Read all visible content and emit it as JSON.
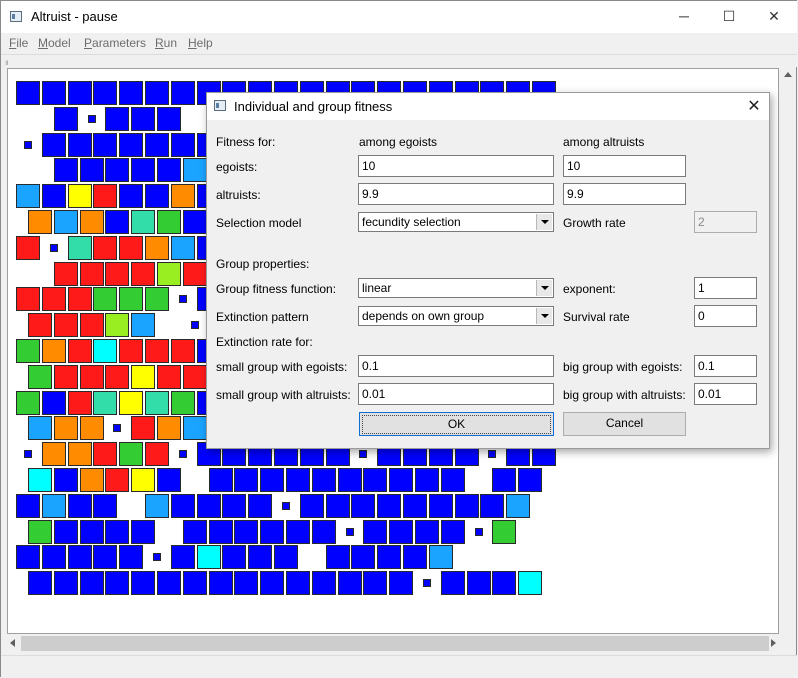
{
  "window": {
    "title": "Altruist - pause",
    "minimize": "─",
    "maximize": "☐",
    "close": "✕"
  },
  "menu": [
    {
      "label": "File",
      "key": "F",
      "rest": "ile"
    },
    {
      "label": "Model",
      "key": "M",
      "rest": "odel"
    },
    {
      "label": "Parameters",
      "key": "P",
      "rest": "arameters"
    },
    {
      "label": "Run",
      "key": "R",
      "rest": "un"
    },
    {
      "label": "Help",
      "key": "H",
      "rest": "elp"
    }
  ],
  "colors": {
    "blue": "#0000ff",
    "lightblue": "#1aa3ff",
    "skyblue": "#00b0ff",
    "cyan": "#00ffff",
    "turquoise": "#33e6e6",
    "teal": "#33ddaa",
    "green": "#33cc33",
    "lime": "#99ee22",
    "yellow": "#ffff00",
    "amber": "#ffcc00",
    "orange": "#ff8c00",
    "darkorange": "#ff6600",
    "redorange": "#ff3300",
    "red": "#ff1a1a"
  },
  "dialog": {
    "title": "Individual and group fitness",
    "close": "✕",
    "fitness_for_label": "Fitness for:",
    "among_egoists": "among egoists",
    "among_altruists": "among altruists",
    "egoists_label": "egoists:",
    "egoists_among_egoists": "10",
    "egoists_among_altruists": "10",
    "altruists_label": "altruists:",
    "altruists_among_egoists": "9.9",
    "altruists_among_altruists": "9.9",
    "selection_model_label": "Selection model",
    "selection_model": "fecundity selection",
    "growth_rate_label": "Growth rate",
    "growth_rate": "2",
    "group_properties_label": "Group properties:",
    "group_fitness_function_label": "Group fitness function:",
    "group_fitness_function": "linear",
    "exponent_label": "exponent:",
    "exponent": "1",
    "extinction_pattern_label": "Extinction pattern",
    "extinction_pattern": "depends on own group",
    "survival_rate_label": "Survival rate",
    "survival_rate": "0",
    "extinction_rate_for_label": "Extinction rate for:",
    "small_egoists_label": "small group with egoists:",
    "small_egoists": "0.1",
    "big_egoists_label": "big group with egoists:",
    "big_egoists": "0.1",
    "small_altruists_label": "small group with altruists:",
    "small_altruists": "0.01",
    "big_altruists_label": "big group with altruists:",
    "big_altruists": "0.01",
    "ok_label": "OK",
    "cancel_label": "Cancel"
  },
  "grid": {
    "rows": [
      "BBBBBBBBBBBBBBBBBBBBBB",
      "-BsBBB-sBBBBBBBBBBBBBB",
      "sBBBBBBBBBBBBBBBBBBBBB",
      "-BBBBBLBBBBBBBBBBBBBBB",
      "LBYRBBOBBBBBBBBBBBBBBB",
      "OLOBTGBBBBBBBBBBBBBBBB",
      "RsTRROLBBBBBBBBBBBBBBB",
      "-RRRRIRBBBBBBBBBBBBBBB",
      "RRRGGGsBBBBBBBBBBBBBBB",
      "RRRIL-sBBBBBBBBBBBBBBB",
      "GORCRRRBBBBBBBBBBBBBBB",
      "GRRRYRRBBBBBBBBBBBBBBB",
      "GBRTYTGBBBBBBBBBBBBBBB",
      "LOOsROLBBBBBBBBBBBBBBB",
      "sOORGRsBBBBBBsBBBBsBB-",
      "CBORYB-BBBBBBBBBB-BB--",
      "BLBB-LBBBBsBBBBBBBBL--",
      "GBBBB-BBBBBBsBBBBsG---",
      "BBBBBsBCBBB-BBBBL-----",
      "BBBBBBBBBBBBBBBsBBBC--"
    ]
  }
}
